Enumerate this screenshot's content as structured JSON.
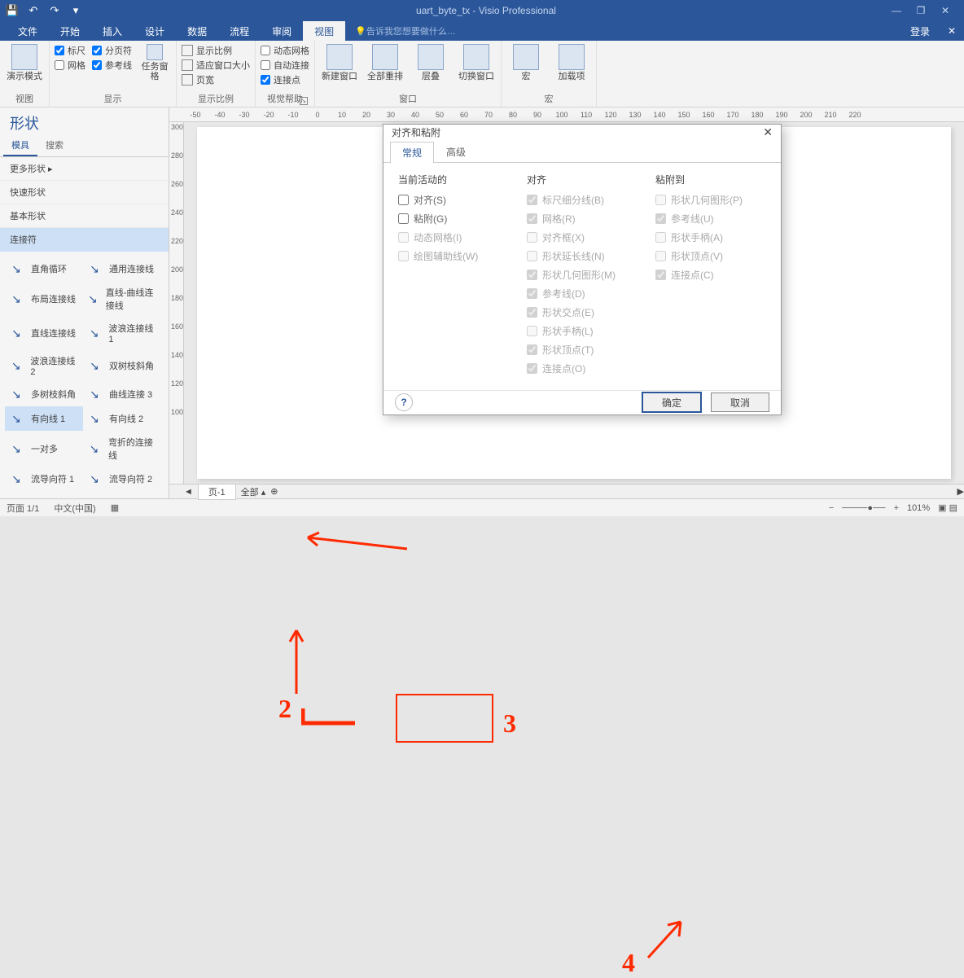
{
  "titlebar": {
    "doc_name": "uart_byte_tx",
    "app_name": "Visio Professional"
  },
  "win_controls": {
    "min": "—",
    "max": "❐",
    "close": "✕"
  },
  "tabs": {
    "file": "文件",
    "home": "开始",
    "insert": "插入",
    "design": "设计",
    "data": "数据",
    "process": "流程",
    "review": "审阅",
    "view": "视图",
    "tell_me": "告诉我您想要做什么…",
    "signin": "登录"
  },
  "ribbon": {
    "presentation_mode": "演示模式",
    "view_group": "视图",
    "ruler": "标尺",
    "pagebreak": "分页符",
    "grid": "网格",
    "guides": "参考线",
    "task_pane": "任务窗格",
    "show_group": "显示",
    "show_scale": "显示比例",
    "fit_window": "适应窗口大小",
    "page_width": "页宽",
    "scale_group": "显示比例",
    "dyn_grid": "动态网格",
    "auto_connect": "自动连接",
    "conn_points": "连接点",
    "visual_help_group": "视觉帮助",
    "new_window": "新建窗口",
    "arrange_all": "全部重排",
    "cascade": "层叠",
    "switch_win": "切换窗口",
    "window_group": "窗口",
    "macros": "宏",
    "addins": "加载项",
    "macro_group": "宏"
  },
  "shapes": {
    "title": "形状",
    "tab_stencil": "模具",
    "tab_search": "搜索",
    "more_shapes": "更多形状",
    "quick_shapes": "快速形状",
    "basic_shapes": "基本形状",
    "connectors": "连接符",
    "items": [
      [
        "直角循环",
        "通用连接线"
      ],
      [
        "布局连接线",
        "直线-曲线连接线"
      ],
      [
        "直线连接线",
        "波浪连接线 1"
      ],
      [
        "波浪连接线 2",
        "双树枝斜角"
      ],
      [
        "多树枝斜角",
        "曲线连接 3"
      ],
      [
        "有向线 1",
        "有向线 2"
      ],
      [
        "一对多",
        "弯折的连接线"
      ],
      [
        "流导向符 1",
        "流导向符 2"
      ]
    ],
    "selected": "有向线 1"
  },
  "ruler_h": [
    "-50",
    "-40",
    "-30",
    "-20",
    "-10",
    "0",
    "10",
    "20",
    "30",
    "40",
    "50",
    "60",
    "70",
    "80",
    "90",
    "100",
    "110",
    "120",
    "130",
    "140",
    "150",
    "160",
    "170",
    "180",
    "190",
    "200",
    "210",
    "220"
  ],
  "ruler_v": [
    "300",
    "280",
    "260",
    "240",
    "220",
    "200",
    "180",
    "160",
    "140",
    "120",
    "100"
  ],
  "page_tabs": {
    "page1": "页-1",
    "all": "全部"
  },
  "status": {
    "page": "页面 1/1",
    "lang": "中文(中国)",
    "zoom": "101%"
  },
  "dialog": {
    "title": "对齐和粘附",
    "tab_general": "常规",
    "tab_advanced": "高级",
    "col1_title": "当前活动的",
    "col1": [
      {
        "label": "对齐(S)",
        "checked": false,
        "dis": false
      },
      {
        "label": "粘附(G)",
        "checked": false,
        "dis": false
      },
      {
        "label": "动态网格(I)",
        "checked": false,
        "dis": true
      },
      {
        "label": "绘图辅助线(W)",
        "checked": false,
        "dis": true
      }
    ],
    "col2_title": "对齐",
    "col2": [
      {
        "label": "标尺细分线(B)",
        "checked": true,
        "dis": true
      },
      {
        "label": "网格(R)",
        "checked": true,
        "dis": true
      },
      {
        "label": "对齐框(X)",
        "checked": false,
        "dis": true
      },
      {
        "label": "形状延长线(N)",
        "checked": false,
        "dis": true
      },
      {
        "label": "形状几何图形(M)",
        "checked": true,
        "dis": true
      },
      {
        "label": "参考线(D)",
        "checked": true,
        "dis": true
      },
      {
        "label": "形状交点(E)",
        "checked": true,
        "dis": true
      },
      {
        "label": "形状手柄(L)",
        "checked": false,
        "dis": true
      },
      {
        "label": "形状顶点(T)",
        "checked": true,
        "dis": true
      },
      {
        "label": "连接点(O)",
        "checked": true,
        "dis": true
      }
    ],
    "col3_title": "粘附到",
    "col3": [
      {
        "label": "形状几何图形(P)",
        "checked": false,
        "dis": true
      },
      {
        "label": "参考线(U)",
        "checked": true,
        "dis": true
      },
      {
        "label": "形状手柄(A)",
        "checked": false,
        "dis": true
      },
      {
        "label": "形状顶点(V)",
        "checked": false,
        "dis": true
      },
      {
        "label": "连接点(C)",
        "checked": true,
        "dis": true
      }
    ],
    "ok": "确定",
    "cancel": "取消"
  },
  "anno": {
    "n2": "2",
    "n3": "3",
    "n4": "4"
  }
}
